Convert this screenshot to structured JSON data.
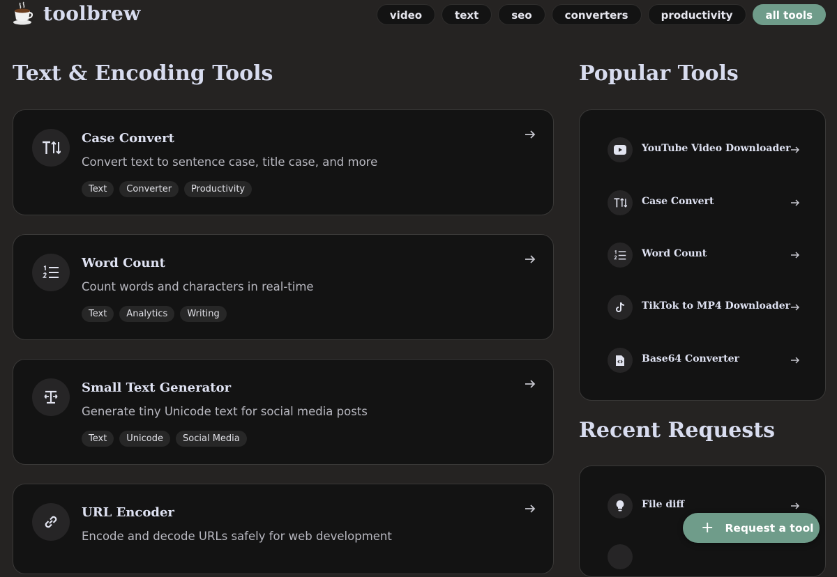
{
  "brand": {
    "name": "toolbrew",
    "logo_icon": "coffee-cup-icon"
  },
  "nav": [
    {
      "label": "video",
      "active": false
    },
    {
      "label": "text",
      "active": false
    },
    {
      "label": "seo",
      "active": false
    },
    {
      "label": "converters",
      "active": false
    },
    {
      "label": "productivity",
      "active": false
    },
    {
      "label": "all tools",
      "active": true
    }
  ],
  "main": {
    "title": "Text & Encoding Tools",
    "tools": [
      {
        "title": "Case Convert",
        "desc": "Convert text to sentence case, title case, and more",
        "icon": "text-case-icon",
        "tags": [
          "Text",
          "Converter",
          "Productivity"
        ]
      },
      {
        "title": "Word Count",
        "desc": "Count words and characters in real-time",
        "icon": "numbered-list-icon",
        "tags": [
          "Text",
          "Analytics",
          "Writing"
        ]
      },
      {
        "title": "Small Text Generator",
        "desc": "Generate tiny Unicode text for social media posts",
        "icon": "small-text-icon",
        "tags": [
          "Text",
          "Unicode",
          "Social Media"
        ]
      },
      {
        "title": "URL Encoder",
        "desc": "Encode and decode URLs safely for web development",
        "icon": "link-icon",
        "tags": []
      }
    ]
  },
  "sidebar": {
    "popular_title": "Popular Tools",
    "popular": [
      {
        "label": "YouTube Video Downloader",
        "icon": "youtube-icon"
      },
      {
        "label": "Case Convert",
        "icon": "text-case-icon"
      },
      {
        "label": "Word Count",
        "icon": "numbered-list-icon"
      },
      {
        "label": "TikTok to MP4 Downloader",
        "icon": "tiktok-icon"
      },
      {
        "label": "Base64 Converter",
        "icon": "code-file-icon"
      }
    ],
    "recent_title": "Recent Requests",
    "recent": [
      {
        "label": "File diff",
        "icon": "lightbulb-icon"
      }
    ]
  },
  "fab": {
    "label": "Request a tool",
    "icon": "plus-icon"
  },
  "colors": {
    "background": "#252322",
    "card": "#131313",
    "accent": "#6f9c8a",
    "heading": "#d8dcef"
  }
}
